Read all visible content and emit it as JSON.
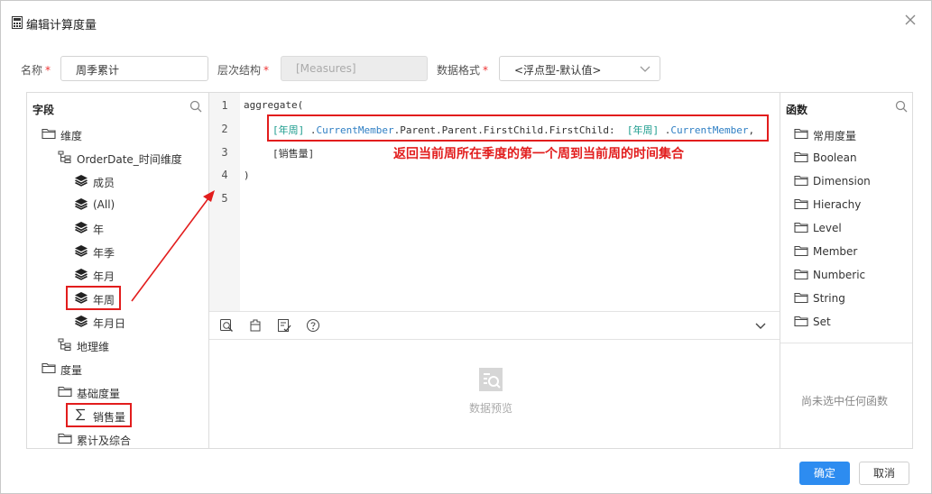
{
  "dialog": {
    "title": "编辑计算度量",
    "close_icon": "close-icon",
    "calculator_icon": "calculator-icon"
  },
  "form": {
    "name_label": "名称",
    "name_value": "周季累计",
    "hierarchy_label": "层次结构",
    "hierarchy_value": "[Measures]",
    "format_label": "数据格式",
    "format_value": "<浮点型-默认值>",
    "required_mark": "*"
  },
  "fields_panel": {
    "title": "字段",
    "items": [
      {
        "label": "维度",
        "icon": "folder-icon"
      },
      {
        "label": "OrderDate_时间维度",
        "icon": "hierarchy-icon"
      },
      {
        "label": "成员",
        "icon": "layers-icon"
      },
      {
        "label": "(All)",
        "icon": "layers-icon"
      },
      {
        "label": "年",
        "icon": "layers-icon"
      },
      {
        "label": "年季",
        "icon": "layers-icon"
      },
      {
        "label": "年月",
        "icon": "layers-icon"
      },
      {
        "label": "年周",
        "icon": "layers-icon"
      },
      {
        "label": "年月日",
        "icon": "layers-icon"
      },
      {
        "label": "地理维",
        "icon": "hierarchy-icon"
      },
      {
        "label": "度量",
        "icon": "folder-icon"
      },
      {
        "label": "基础度量",
        "icon": "folder-icon"
      },
      {
        "label": "销售量",
        "icon": "sigma-icon"
      },
      {
        "label": "累计及综合",
        "icon": "folder-icon"
      }
    ]
  },
  "editor": {
    "line_numbers": [
      "1",
      "2",
      "3",
      "4",
      "5"
    ],
    "line1": "aggregate(",
    "line2": {
      "t1": "[年周]",
      "t2": " .",
      "t3": "CurrentMember",
      "t4": ".Parent.Parent.FirstChild.FirstChild:  ",
      "t5": "[年周]",
      "t6": " .",
      "t7": "CurrentMember",
      "t8": ","
    },
    "line3": "[销售量]",
    "line4": ")",
    "annotation": "返回当前周所在季度的第一个周到当前周的时间集合"
  },
  "toolbar": {
    "icons": [
      "format-icon",
      "clear-icon",
      "check-syntax-icon",
      "help-icon",
      "chevron-down-icon"
    ]
  },
  "preview": {
    "label": "数据预览"
  },
  "functions_panel": {
    "title": "函数",
    "items": [
      "常用度量",
      "Boolean",
      "Dimension",
      "Hierachy",
      "Level",
      "Member",
      "Numberic",
      "String",
      "Set"
    ],
    "empty_hint": "尚未选中任何函数"
  },
  "buttons": {
    "ok": "确定",
    "cancel": "取消"
  },
  "colors": {
    "accent": "#2d8cf0",
    "annotation": "#e21d1d",
    "keyword": "#1a9b8c",
    "member": "#2f7fc4"
  }
}
